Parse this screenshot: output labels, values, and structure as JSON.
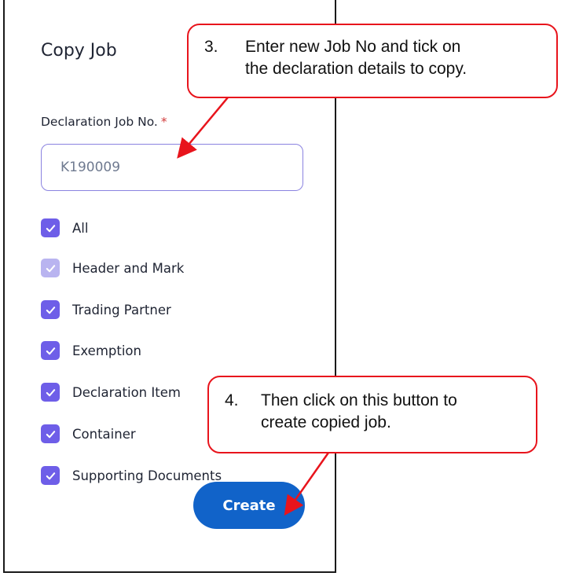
{
  "dialog": {
    "title": "Copy Job",
    "field_label": "Declaration Job No.",
    "required_mark": "*",
    "job_no_value": "K190009",
    "options": [
      {
        "label": "All",
        "checked": true
      },
      {
        "label": "Header and Mark",
        "checked": true,
        "disabled": true
      },
      {
        "label": "Trading Partner",
        "checked": true
      },
      {
        "label": "Exemption",
        "checked": true
      },
      {
        "label": "Declaration Item",
        "checked": true
      },
      {
        "label": "Container",
        "checked": true
      },
      {
        "label": "Supporting Documents",
        "checked": true
      }
    ],
    "create_label": "Create"
  },
  "callouts": {
    "step3": {
      "number": "3.",
      "line1": "Enter new Job No and tick on",
      "line2": "the declaration details to copy."
    },
    "step4": {
      "number": "4.",
      "line1": "Then click on this button to",
      "line2": "create copied job."
    }
  },
  "colors": {
    "checkbox": "#6e5ee8",
    "checkbox_disabled": "#b9b4f0",
    "button": "#1163c9",
    "callout_border": "#e8141c",
    "input_border": "#8a82e0"
  }
}
